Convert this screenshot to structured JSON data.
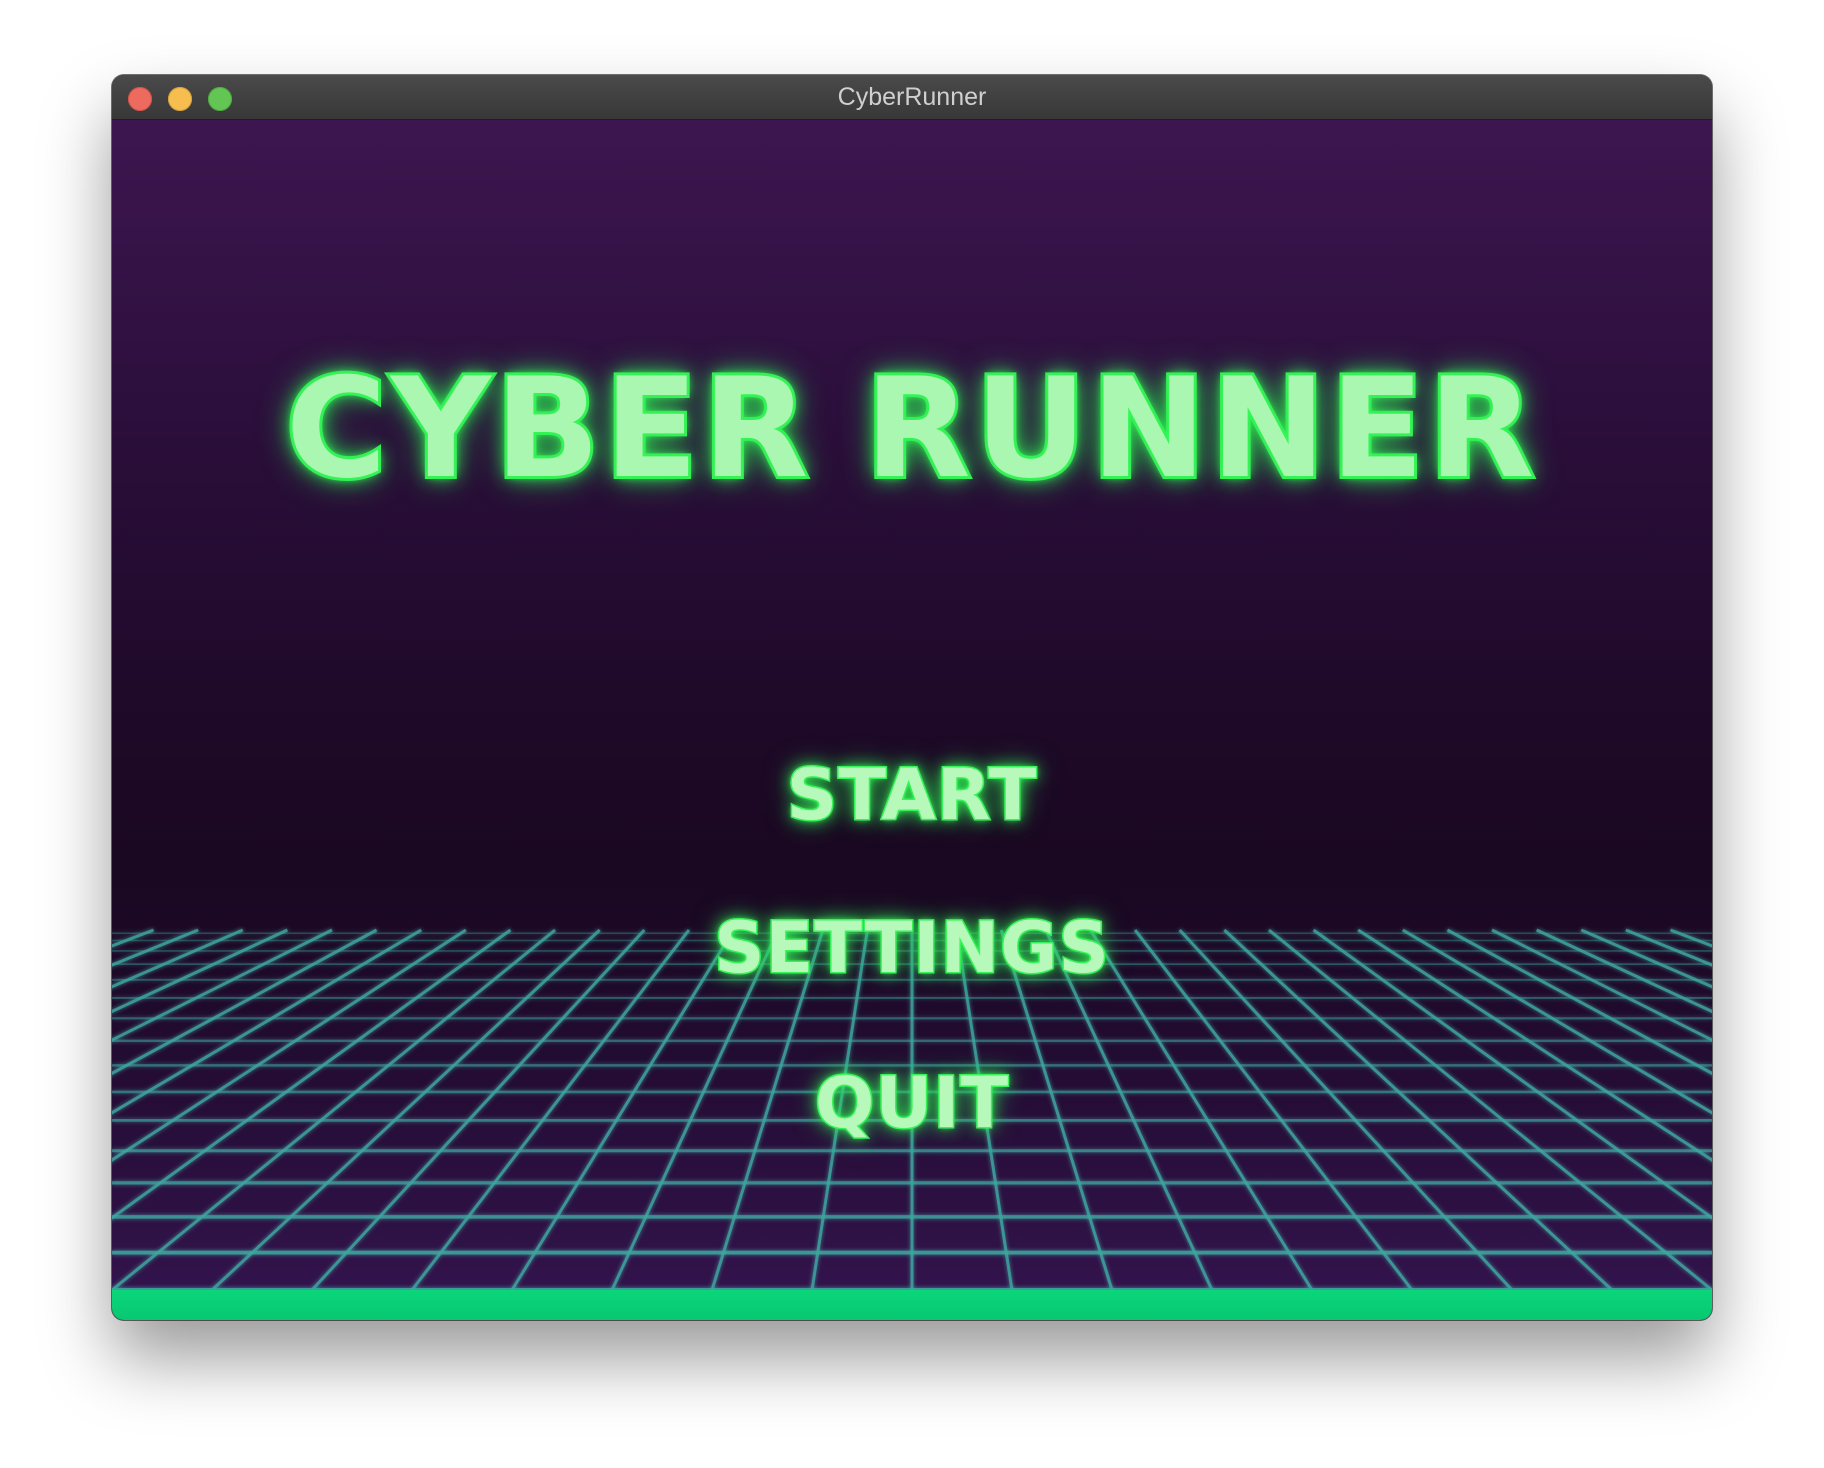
{
  "window": {
    "title": "CyberRunner"
  },
  "game": {
    "title": "CYBER RUNNER",
    "menu": {
      "start_label": "START",
      "settings_label": "SETTINGS",
      "quit_label": "QUIT"
    }
  },
  "colors": {
    "neon_green": "#3cf05a",
    "text_fill": "#a9f7b0",
    "grid_line": "#3fa6a0",
    "ground": "#0ad67a",
    "background_top": "#3d1650",
    "background_mid": "#1a0721"
  }
}
